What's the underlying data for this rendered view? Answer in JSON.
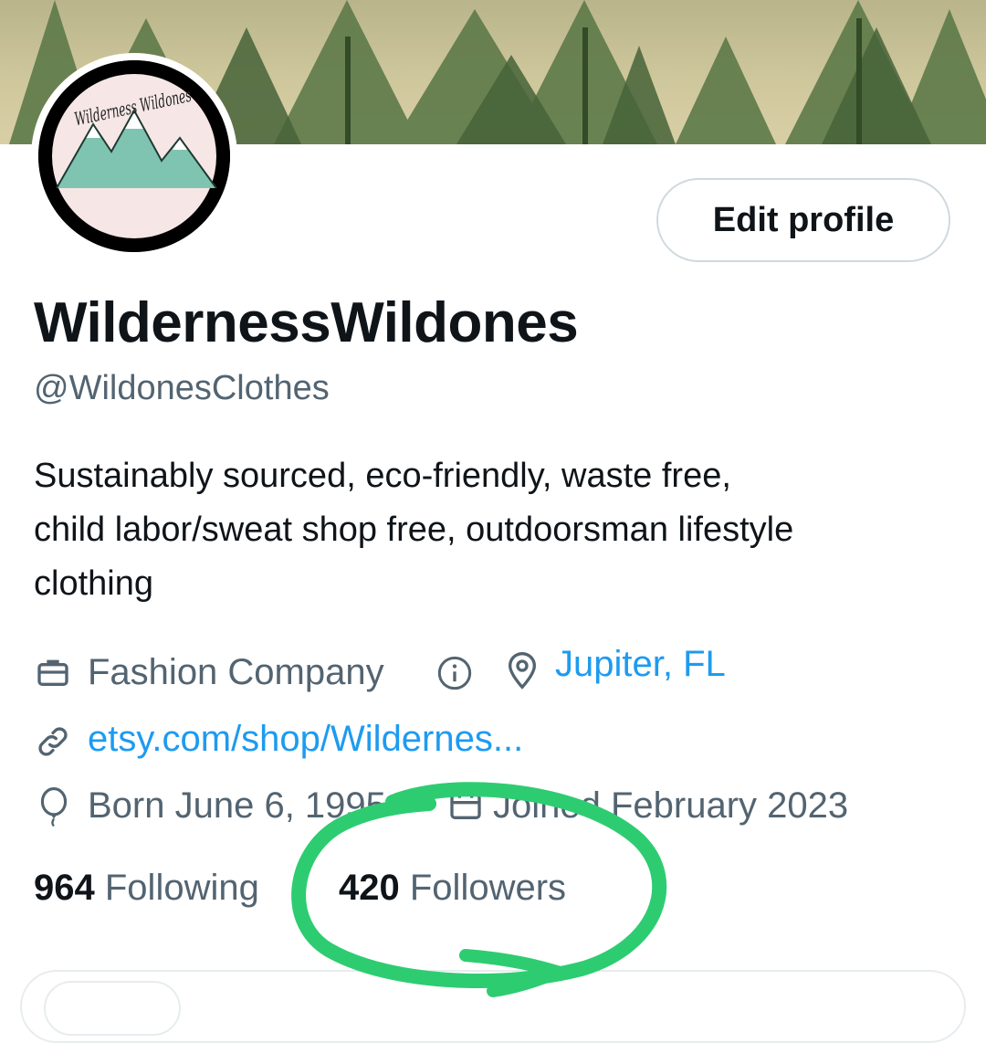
{
  "profile": {
    "avatar_text": "Wilderness Wildones",
    "display_name": "WildernessWildones",
    "handle": "@WildonesClothes",
    "bio_lines": [
      "Sustainably sourced, eco-friendly, waste free,",
      "child labor/sweat shop free, outdoorsman lifestyle",
      "clothing"
    ]
  },
  "actions": {
    "edit_profile": "Edit profile"
  },
  "meta": {
    "category": "Fashion Company",
    "location": "Jupiter, FL",
    "website": "etsy.com/shop/Wildernes...",
    "birth": "Born June 6, 1995",
    "joined": "Joined February 2023"
  },
  "stats": {
    "following_count": "964",
    "following_label": "Following",
    "followers_count": "420",
    "followers_label": "Followers"
  },
  "icons": {
    "category": "briefcase-icon",
    "info": "info-icon",
    "location": "location-pin-icon",
    "website": "link-icon",
    "birth": "balloon-icon",
    "joined": "calendar-icon"
  },
  "colors": {
    "text_primary": "#0f1419",
    "text_secondary": "#536471",
    "link": "#1d9bf0",
    "annotation": "#2ecc71"
  }
}
